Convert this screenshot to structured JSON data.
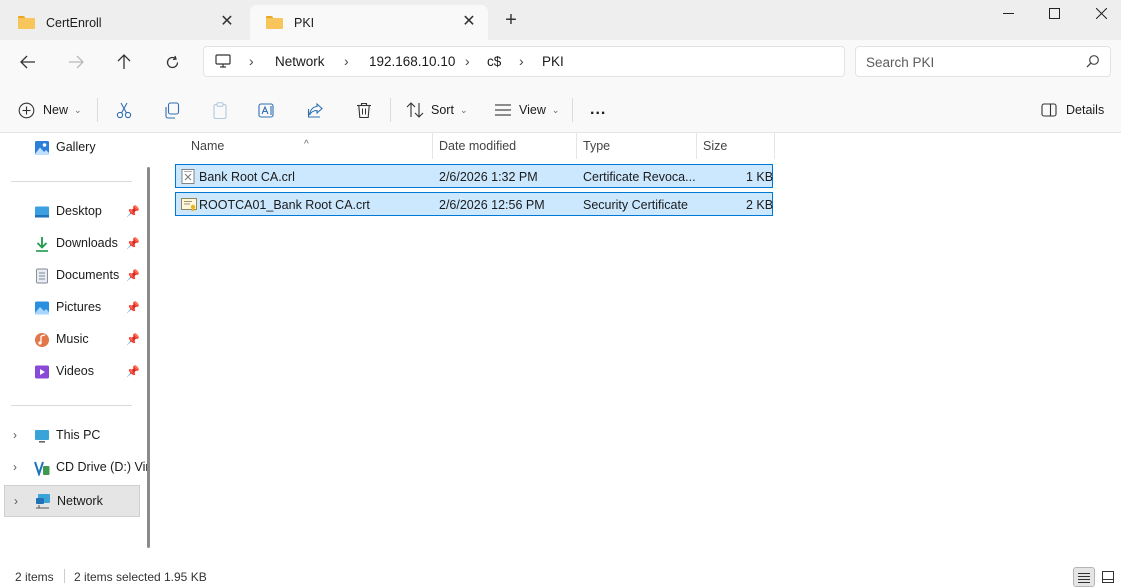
{
  "tabs": [
    {
      "label": "CertEnroll",
      "active": false
    },
    {
      "label": "PKI",
      "active": true
    }
  ],
  "window_controls": {
    "minimize": "—",
    "maximize": "☐",
    "close": "✕"
  },
  "breadcrumb": [
    "Network",
    "192.168.10.10",
    "c$",
    "PKI"
  ],
  "search": {
    "placeholder": "Search PKI"
  },
  "commands": {
    "new": "New",
    "sort": "Sort",
    "view": "View",
    "more": "...",
    "details": "Details"
  },
  "sidebar": {
    "gallery": "Gallery",
    "quick_access": [
      {
        "label": "Desktop",
        "icon": "desktop-icon"
      },
      {
        "label": "Downloads",
        "icon": "downloads-icon"
      },
      {
        "label": "Documents",
        "icon": "documents-icon"
      },
      {
        "label": "Pictures",
        "icon": "pictures-icon"
      },
      {
        "label": "Music",
        "icon": "music-icon"
      },
      {
        "label": "Videos",
        "icon": "videos-icon"
      }
    ],
    "this_pc": "This PC",
    "cd_drive": "CD Drive (D:) Vir",
    "network": "Network"
  },
  "columns": {
    "name": "Name",
    "date": "Date modified",
    "type": "Type",
    "size": "Size"
  },
  "files": [
    {
      "name": "Bank Root CA.crl",
      "date": "2/6/2026 1:32 PM",
      "type": "Certificate Revoca...",
      "size": "1 KB",
      "icon": "crl-file-icon"
    },
    {
      "name": "ROOTCA01_Bank Root CA.crt",
      "date": "2/6/2026 12:56 PM",
      "type": "Security Certificate",
      "size": "2 KB",
      "icon": "certificate-file-icon"
    }
  ],
  "status": {
    "items": "2 items",
    "selected": "2 items selected",
    "size": "1.95 KB"
  },
  "colors": {
    "selection_bg": "#cce8ff",
    "selection_border": "#0078d4",
    "chrome": "#f9f9f9"
  }
}
